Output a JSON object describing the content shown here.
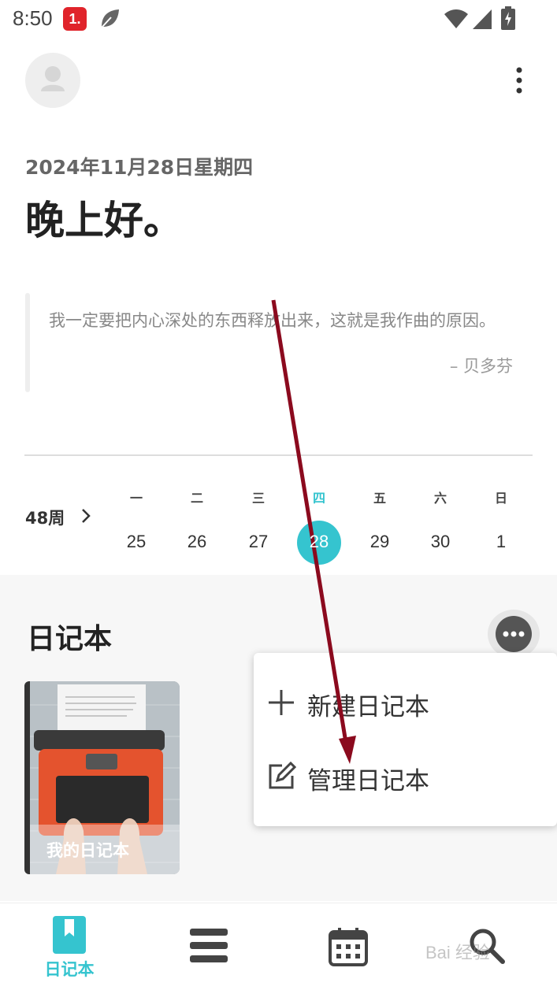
{
  "status_bar": {
    "time": "8:50",
    "notification_badge": "1."
  },
  "header": {
    "date": "2024年11月28日星期四",
    "greeting": "晚上好。"
  },
  "quote": {
    "text": "我一定要把内心深处的东西释放出来，这就是我作曲的原因。",
    "author": "– 贝多芬"
  },
  "week": {
    "label": "48周",
    "days": [
      {
        "name": "一",
        "num": "25"
      },
      {
        "name": "二",
        "num": "26"
      },
      {
        "name": "三",
        "num": "27"
      },
      {
        "name": "四",
        "num": "28",
        "today": true
      },
      {
        "name": "五",
        "num": "29"
      },
      {
        "name": "六",
        "num": "30"
      },
      {
        "name": "日",
        "num": "1"
      }
    ]
  },
  "notebooks": {
    "title": "日记本",
    "items": [
      {
        "label": "我的日记本"
      }
    ]
  },
  "menu": {
    "items": [
      {
        "label": "新建日记本",
        "icon": "plus-icon"
      },
      {
        "label": "管理日记本",
        "icon": "edit-icon"
      }
    ]
  },
  "bottom_nav": {
    "items": [
      {
        "label": "日记本",
        "icon": "bookmark-icon",
        "active": true
      },
      {
        "label": "",
        "icon": "list-icon"
      },
      {
        "label": "",
        "icon": "calendar-icon"
      },
      {
        "label": "",
        "icon": "search-icon"
      }
    ]
  },
  "watermark": "Bai 经验",
  "colors": {
    "accent": "#35c4cf",
    "annotation_arrow": "#8b0a1e"
  }
}
